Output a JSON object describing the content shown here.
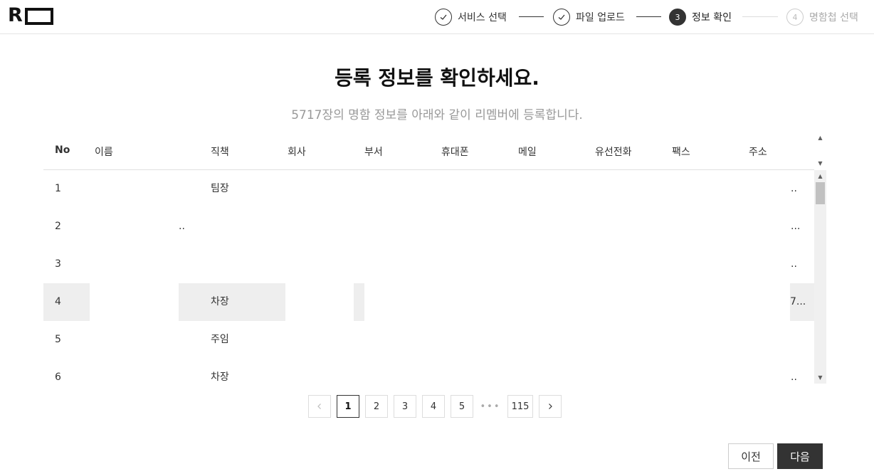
{
  "header": {
    "logo_letter": "R",
    "steps": [
      {
        "num": "",
        "label": "서비스 선택",
        "state": "done"
      },
      {
        "num": "",
        "label": "파일 업로드",
        "state": "done"
      },
      {
        "num": "3",
        "label": "정보 확인",
        "state": "active"
      },
      {
        "num": "4",
        "label": "명함첩 선택",
        "state": "pending"
      }
    ]
  },
  "main": {
    "title": "등록 정보를 확인하세요.",
    "subtitle": "5717장의 명함 정보를 아래와 같이 리멤버에 등록합니다."
  },
  "table": {
    "columns": [
      "No",
      "이름",
      "직책",
      "회사",
      "부서",
      "휴대폰",
      "메일",
      "유선전화",
      "팩스",
      "주소"
    ],
    "rows": [
      {
        "no": "1",
        "name": "",
        "title": "팀장",
        "company": "",
        "address": ".."
      },
      {
        "no": "2",
        "name": "..",
        "title": "",
        "company": "",
        "address": "..."
      },
      {
        "no": "3",
        "name": "",
        "title": "",
        "company": "",
        "address": ".."
      },
      {
        "no": "4",
        "name": "",
        "title": "차장",
        "company": "",
        "address": "7..."
      },
      {
        "no": "5",
        "name": "",
        "title": "주임",
        "company": "",
        "address": ""
      },
      {
        "no": "6",
        "name": "",
        "title": "차장",
        "company": "",
        "address": ".."
      }
    ]
  },
  "pagination": {
    "pages": [
      "1",
      "2",
      "3",
      "4",
      "5"
    ],
    "current": "1",
    "ellipsis": "•••",
    "last": "115"
  },
  "footer": {
    "prev_label": "이전",
    "next_label": "다음"
  },
  "icons": {
    "check": "check-icon",
    "chevron_left": "chevron-left-icon",
    "chevron_right": "chevron-right-icon"
  },
  "colors": {
    "primary": "#333333",
    "highlight": "#eeeeee",
    "muted": "#999999"
  }
}
